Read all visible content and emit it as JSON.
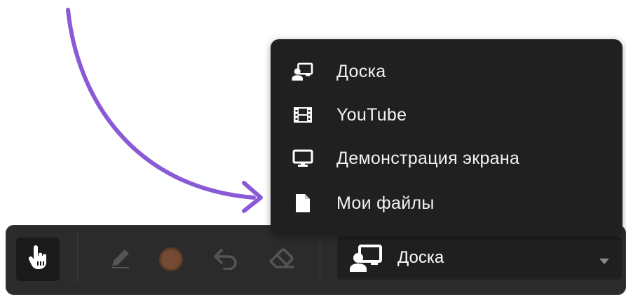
{
  "menu": {
    "items": [
      {
        "label": "Доска",
        "icon": "whiteboard-icon"
      },
      {
        "label": "YouTube",
        "icon": "film-icon"
      },
      {
        "label": "Демонстрация экрана",
        "icon": "monitor-icon"
      },
      {
        "label": "Мои файлы",
        "icon": "file-icon"
      }
    ]
  },
  "toolbar": {
    "tools": [
      "hand-icon",
      "pencil-icon",
      "color-swatch",
      "undo-icon",
      "eraser-icon"
    ],
    "color_value": "#754a33",
    "select": {
      "value": "Доска",
      "icon": "whiteboard-icon"
    }
  },
  "colors": {
    "arrow": "#8a5ad6",
    "menu_bg": "#202020",
    "toolbar_bg": "#2b2b2b"
  }
}
